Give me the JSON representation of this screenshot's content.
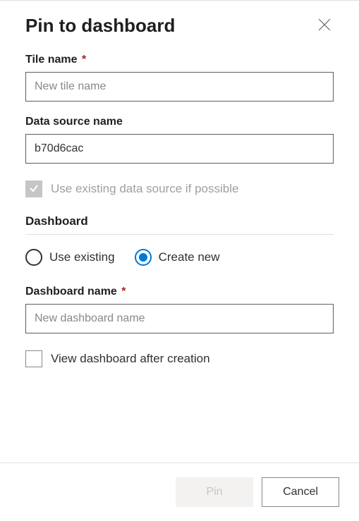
{
  "dialog": {
    "title": "Pin to dashboard"
  },
  "tileName": {
    "label": "Tile name",
    "placeholder": "New tile name",
    "value": ""
  },
  "dataSourceName": {
    "label": "Data source name",
    "value": "b70d6cac"
  },
  "useExistingDataSource": {
    "label": "Use existing data source if possible"
  },
  "dashboardSection": {
    "heading": "Dashboard",
    "radio": {
      "existing": "Use existing",
      "create": "Create new"
    }
  },
  "dashboardName": {
    "label": "Dashboard name",
    "placeholder": "New dashboard name",
    "value": ""
  },
  "viewAfterCreate": {
    "label": "View dashboard after creation"
  },
  "footer": {
    "pin": "Pin",
    "cancel": "Cancel"
  }
}
